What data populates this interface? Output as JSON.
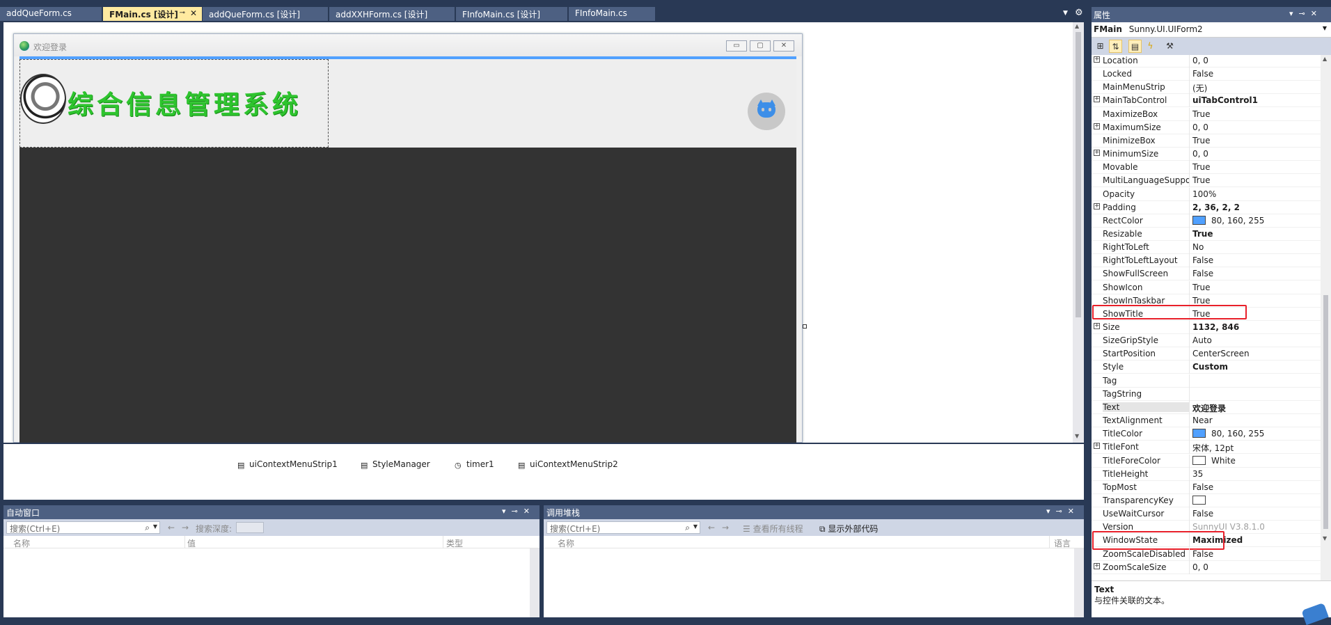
{
  "tabs": [
    {
      "label": "addQueForm.cs",
      "active": false
    },
    {
      "label": "FMain.cs [设计]",
      "active": true
    },
    {
      "label": "addQueForm.cs [设计]",
      "active": false
    },
    {
      "label": "addXXHForm.cs [设计]",
      "active": false
    },
    {
      "label": "FInfoMain.cs [设计]",
      "active": false
    },
    {
      "label": "FInfoMain.cs",
      "active": false
    }
  ],
  "tab_icons": {
    "pin": "pin-icon",
    "close": "close-icon",
    "dropdown": "chevron-down-icon",
    "settings": "gear-icon"
  },
  "form": {
    "title": "欢迎登录",
    "logo_text": "综合信息管理系统",
    "window_buttons": {
      "minimize": "▭",
      "maximize": "▢",
      "close": "✕"
    },
    "rect_color": "#50a0ff",
    "body_color": "#333333"
  },
  "tray": {
    "items": [
      {
        "label": "uiContextMenuStrip1",
        "icon": "context-menu-icon"
      },
      {
        "label": "StyleManager",
        "icon": "component-icon"
      },
      {
        "label": "timer1",
        "icon": "timer-icon"
      },
      {
        "label": "uiContextMenuStrip2",
        "icon": "context-menu-icon"
      }
    ]
  },
  "autos_panel": {
    "title": "自动窗口",
    "search_placeholder": "搜索(Ctrl+E)",
    "search_depth_label": "搜索深度:",
    "columns": [
      "名称",
      "值",
      "类型"
    ]
  },
  "callstack_panel": {
    "title": "调用堆栈",
    "search_placeholder": "搜索(Ctrl+E)",
    "show_all_threads": "查看所有线程",
    "show_external_code": "显示外部代码",
    "columns": [
      "名称",
      "语言"
    ]
  },
  "properties": {
    "title": "属性",
    "object_name": "FMain",
    "object_type": "Sunny.UI.UIForm2",
    "rows": [
      {
        "name": "Location",
        "value": "0, 0",
        "expandable": true,
        "bold": false
      },
      {
        "name": "Locked",
        "value": "False",
        "expandable": false,
        "bold": false
      },
      {
        "name": "MainMenuStrip",
        "value": "(无)",
        "expandable": false,
        "bold": false
      },
      {
        "name": "MainTabControl",
        "value": "uiTabControl1",
        "expandable": true,
        "bold": true
      },
      {
        "name": "MaximizeBox",
        "value": "True",
        "expandable": false,
        "bold": false
      },
      {
        "name": "MaximumSize",
        "value": "0, 0",
        "expandable": true,
        "bold": false
      },
      {
        "name": "MinimizeBox",
        "value": "True",
        "expandable": false,
        "bold": false
      },
      {
        "name": "MinimumSize",
        "value": "0, 0",
        "expandable": true,
        "bold": false
      },
      {
        "name": "Movable",
        "value": "True",
        "expandable": false,
        "bold": false
      },
      {
        "name": "MultiLanguageSuppo",
        "value": "True",
        "expandable": false,
        "bold": false
      },
      {
        "name": "Opacity",
        "value": "100%",
        "expandable": false,
        "bold": false
      },
      {
        "name": "Padding",
        "value": "2, 36, 2, 2",
        "expandable": true,
        "bold": true
      },
      {
        "name": "RectColor",
        "value": "80, 160, 255",
        "expandable": false,
        "bold": false,
        "swatch": "#50a0ff"
      },
      {
        "name": "Resizable",
        "value": "True",
        "expandable": false,
        "bold": true
      },
      {
        "name": "RightToLeft",
        "value": "No",
        "expandable": false,
        "bold": false
      },
      {
        "name": "RightToLeftLayout",
        "value": "False",
        "expandable": false,
        "bold": false
      },
      {
        "name": "ShowFullScreen",
        "value": "False",
        "expandable": false,
        "bold": false
      },
      {
        "name": "ShowIcon",
        "value": "True",
        "expandable": false,
        "bold": false
      },
      {
        "name": "ShowInTaskbar",
        "value": "True",
        "expandable": false,
        "bold": false
      },
      {
        "name": "ShowTitle",
        "value": "True",
        "expandable": false,
        "bold": false
      },
      {
        "name": "Size",
        "value": "1132, 846",
        "expandable": true,
        "bold": true
      },
      {
        "name": "SizeGripStyle",
        "value": "Auto",
        "expandable": false,
        "bold": false
      },
      {
        "name": "StartPosition",
        "value": "CenterScreen",
        "expandable": false,
        "bold": false
      },
      {
        "name": "Style",
        "value": "Custom",
        "expandable": false,
        "bold": true
      },
      {
        "name": "Tag",
        "value": "",
        "expandable": false,
        "bold": false
      },
      {
        "name": "TagString",
        "value": "",
        "expandable": false,
        "bold": false
      },
      {
        "name": "Text",
        "value": "欢迎登录",
        "expandable": false,
        "bold": true,
        "selected": true
      },
      {
        "name": "TextAlignment",
        "value": "Near",
        "expandable": false,
        "bold": false
      },
      {
        "name": "TitleColor",
        "value": "80, 160, 255",
        "expandable": false,
        "bold": false,
        "swatch": "#50a0ff"
      },
      {
        "name": "TitleFont",
        "value": "宋体, 12pt",
        "expandable": true,
        "bold": false
      },
      {
        "name": "TitleForeColor",
        "value": "White",
        "expandable": false,
        "bold": false,
        "swatch": "#ffffff"
      },
      {
        "name": "TitleHeight",
        "value": "35",
        "expandable": false,
        "bold": false
      },
      {
        "name": "TopMost",
        "value": "False",
        "expandable": false,
        "bold": false
      },
      {
        "name": "TransparencyKey",
        "value": "",
        "expandable": false,
        "bold": false,
        "swatch": "#ffffff"
      },
      {
        "name": "UseWaitCursor",
        "value": "False",
        "expandable": false,
        "bold": false
      },
      {
        "name": "Version",
        "value": "SunnyUI V3.8.1.0",
        "expandable": false,
        "bold": false,
        "gray": true
      },
      {
        "name": "WindowState",
        "value": "Maximized",
        "expandable": false,
        "bold": true
      },
      {
        "name": "ZoomScaleDisabled",
        "value": "False",
        "expandable": false,
        "bold": false
      },
      {
        "name": "ZoomScaleSize",
        "value": "0, 0",
        "expandable": true,
        "bold": false
      }
    ],
    "highlighted": [
      "ShowTitle",
      "WindowState"
    ],
    "description_title": "Text",
    "description_text": "与控件关联的文本。"
  },
  "colors": {
    "highlight": "#e8202a",
    "panel_header": "#4d6082",
    "active_tab": "#ffeaa0",
    "logo_green": "#2ec42e"
  }
}
